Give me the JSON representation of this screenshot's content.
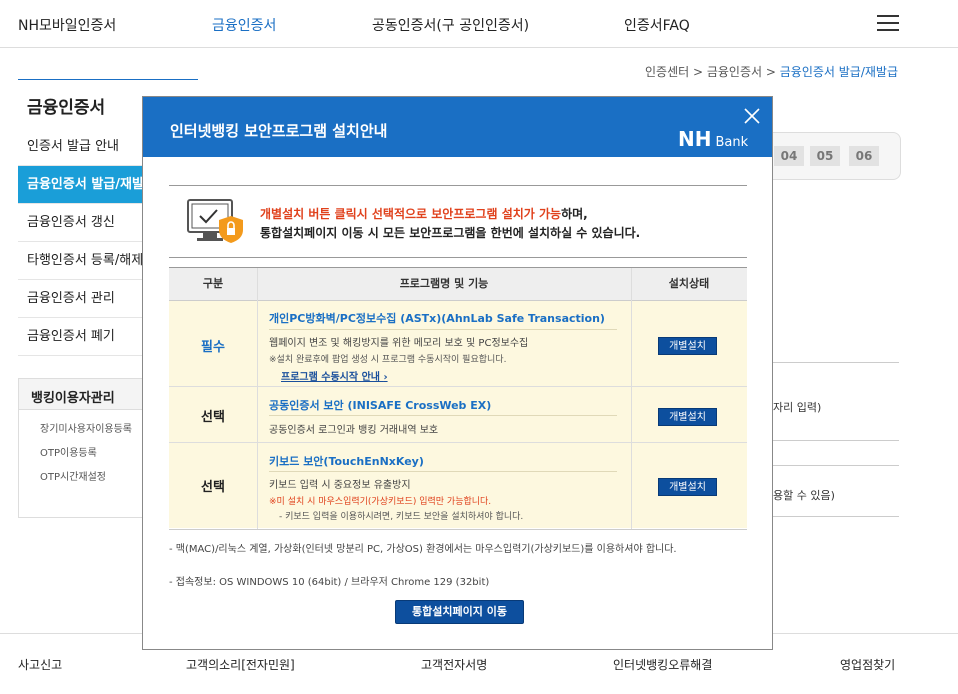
{
  "topnav": {
    "items": [
      "NH모바일인증서",
      "금융인증서",
      "공동인증서(구 공인인증서)",
      "인증서FAQ"
    ],
    "active_index": 1
  },
  "breadcrumb": {
    "parts": [
      "인증센터",
      "금융인증서"
    ],
    "current": "금융인증서 발급/재발급"
  },
  "sidebar": {
    "title": "금융인증서",
    "items": [
      "인증서 발급 안내",
      "금융인증서 발급/재발급",
      "금융인증서 갱신",
      "타행인증서 등록/해제",
      "금융인증서 관리",
      "금융인증서 폐기"
    ],
    "active_index": 1,
    "box_title": "뱅킹이용자관리",
    "box_items": [
      "장기미사용자이용등록",
      "OTP이용등록",
      "OTP시간재설정"
    ]
  },
  "steps": [
    "04",
    "05",
    "06"
  ],
  "background_text": [
    "자리 입력)",
    "용할 수 있음)"
  ],
  "modal": {
    "title": "인터넷뱅킹 보안프로그램 설치안내",
    "logo_nh": "NH",
    "logo_bank": "Bank",
    "alert_red": "개별설치 버튼 클릭시 선택적으로 보안프로그램 설치가 가능",
    "alert_rest": "하며,",
    "alert_line2": "통합설치페이지 이동 시 모든 보안프로그램을 한번에 설치하실 수 있습니다.",
    "table": {
      "headers": [
        "구분",
        "프로그램명 및 기능",
        "설치상태"
      ],
      "rows": [
        {
          "category": "필수",
          "name": "개인PC방화벽/PC정보수집 (ASTx)(AhnLab Safe Transaction)",
          "desc": "웹페이지 변조 및 해킹방지를 위한 메모리 보호 및 PC정보수집",
          "note": "※설치 완료후에 팝업 생성 시 프로그램 수동시작이 필요합니다.",
          "link": "프로그램 수동시작 안내",
          "button": "개별설치"
        },
        {
          "category": "선택",
          "name": "공동인증서 보안 (INISAFE CrossWeb EX)",
          "desc": "공동인증서 로그인과 뱅킹 거래내역 보호",
          "button": "개별설치"
        },
        {
          "category": "선택",
          "name": "키보드 보안(TouchEnNxKey)",
          "desc": "키보드 입력 시 중요정보 유출방지",
          "note_red": "※미 설치 시 마우스입력기(가상키보드) 입력만 가능합니다.",
          "note": "- 키보드 입력을 이용하시려면, 키보드 보안을 설치하셔야 합니다.",
          "button": "개별설치"
        }
      ]
    },
    "notes": [
      "- 맥(MAC)/리눅스 계열, 가상화(인터넷 망분리 PC, 가상OS) 환경에서는 마우스입력기(가상키보드)를 이용하셔야 합니다.",
      "- 접속정보: OS WINDOWS 10 (64bit) / 브라우저 Chrome 129 (32bit)"
    ],
    "go_button": "통합설치페이지 이동"
  },
  "footer": {
    "items": [
      "사고신고",
      "고객의소리[전자민원]",
      "고객전자서명",
      "인터넷뱅킹오류해결",
      "영업점찾기"
    ]
  }
}
